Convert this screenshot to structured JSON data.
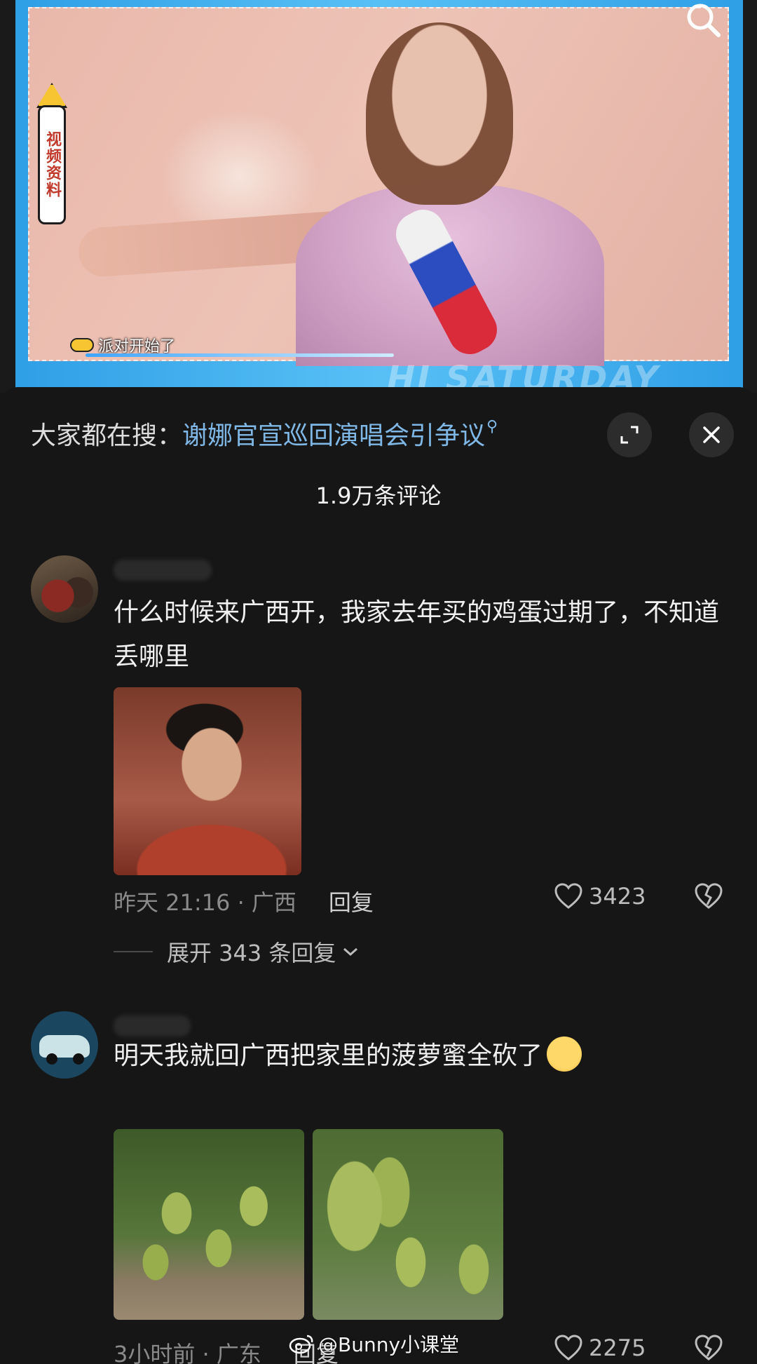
{
  "video": {
    "side_tag": "视频资料",
    "caption": "派对开始了",
    "watermark": "HI SATURDAY"
  },
  "panel": {
    "hot_search_prefix": "大家都在搜：",
    "hot_search_link": "谢娜官宣巡回演唱会引争议",
    "comment_count": "1.9万条评论"
  },
  "comments": [
    {
      "text": "什么时候来广西开，我家去年买的鸡蛋过期了，不知道丢哪里",
      "time_location": "昨天 21:16 · 广西",
      "reply_label": "回复",
      "likes": "3423",
      "expand_label": "展开 343 条回复"
    },
    {
      "text": "明天我就回广西把家里的菠萝蜜全砍了",
      "time_location": "3小时前 · 广东",
      "reply_label": "回复",
      "likes": "2275"
    }
  ],
  "watermark": "@Bunny小课堂"
}
